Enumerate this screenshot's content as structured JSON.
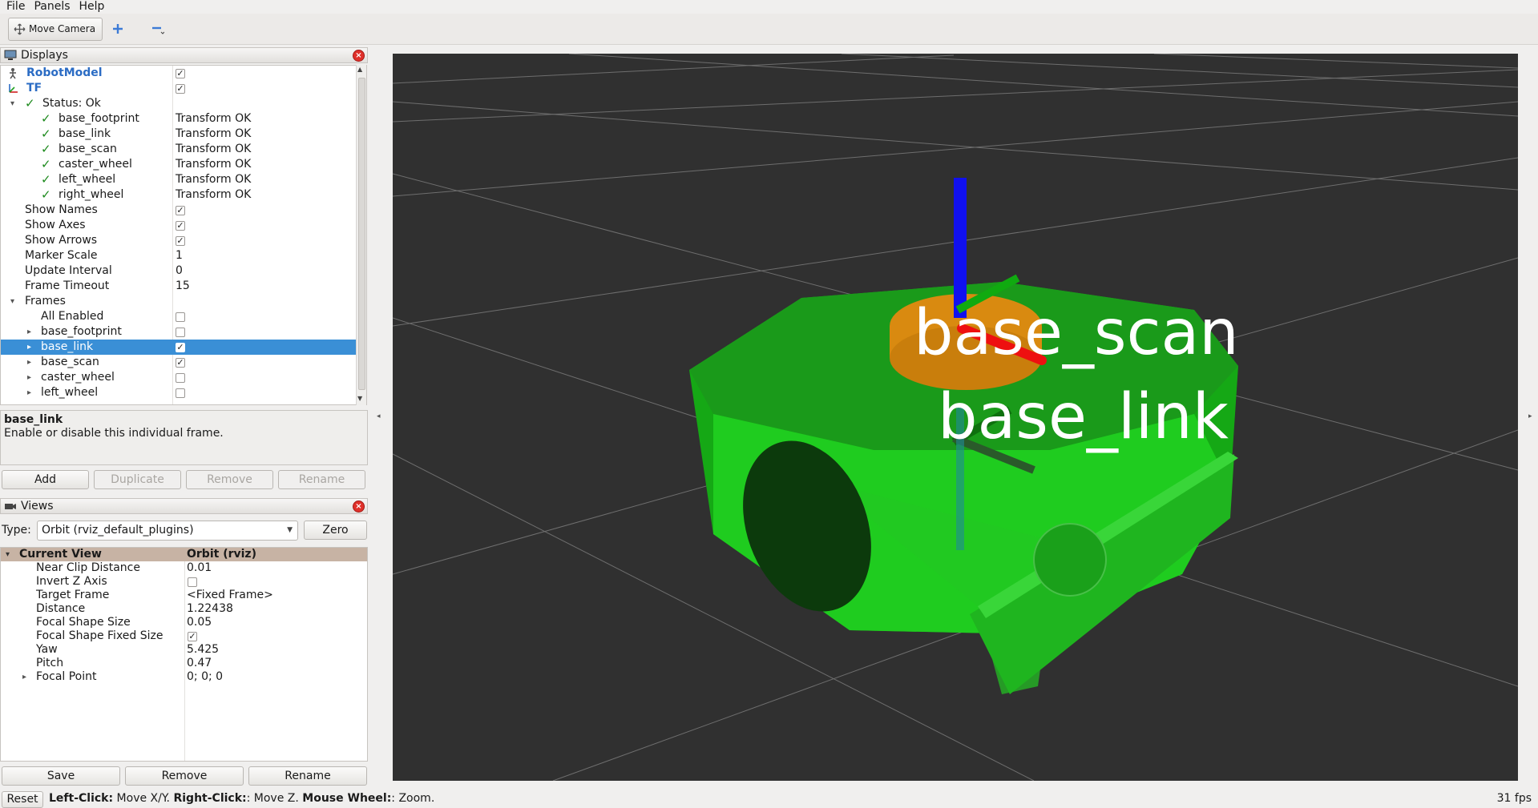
{
  "menu": [
    "File",
    "Panels",
    "Help"
  ],
  "toolbar": {
    "move_camera": "Move Camera"
  },
  "displays_panel": {
    "title": "Displays",
    "rows": [
      {
        "label": "RobotModel",
        "value": "",
        "checked": true
      },
      {
        "label": "TF",
        "value": "",
        "checked": true
      },
      {
        "label": "Status: Ok",
        "value": ""
      },
      {
        "label": "base_footprint",
        "value": "Transform OK"
      },
      {
        "label": "base_link",
        "value": "Transform OK"
      },
      {
        "label": "base_scan",
        "value": "Transform OK"
      },
      {
        "label": "caster_wheel",
        "value": "Transform OK"
      },
      {
        "label": "left_wheel",
        "value": "Transform OK"
      },
      {
        "label": "right_wheel",
        "value": "Transform OK"
      },
      {
        "label": "Show Names",
        "value": "",
        "checked": true
      },
      {
        "label": "Show Axes",
        "value": "",
        "checked": true
      },
      {
        "label": "Show Arrows",
        "value": "",
        "checked": true
      },
      {
        "label": "Marker Scale",
        "value": "1"
      },
      {
        "label": "Update Interval",
        "value": "0"
      },
      {
        "label": "Frame Timeout",
        "value": "15"
      },
      {
        "label": "Frames",
        "value": ""
      },
      {
        "label": "All Enabled",
        "value": "",
        "checked": false
      },
      {
        "label": "base_footprint",
        "value": "",
        "checked": false
      },
      {
        "label": "base_link",
        "value": "",
        "checked": true
      },
      {
        "label": "base_scan",
        "value": "",
        "checked": true
      },
      {
        "label": "caster_wheel",
        "value": "",
        "checked": false
      },
      {
        "label": "left_wheel",
        "value": "",
        "checked": false
      }
    ],
    "desc_title": "base_link",
    "desc_text": "Enable or disable this individual frame.",
    "buttons": [
      "Add",
      "Duplicate",
      "Remove",
      "Rename"
    ]
  },
  "views_panel": {
    "title": "Views",
    "type_label": "Type:",
    "type_value": "Orbit (rviz_default_plugins)",
    "zero_label": "Zero",
    "header_label": "Current View",
    "header_value": "Orbit (rviz)",
    "rows": [
      {
        "label": "Near Clip Distance",
        "value": "0.01"
      },
      {
        "label": "Invert Z Axis",
        "value": ""
      },
      {
        "label": "Target Frame",
        "value": "<Fixed Frame>"
      },
      {
        "label": "Distance",
        "value": "1.22438"
      },
      {
        "label": "Focal Shape Size",
        "value": "0.05"
      },
      {
        "label": "Focal Shape Fixed Size",
        "value": ""
      },
      {
        "label": "Yaw",
        "value": "5.425"
      },
      {
        "label": "Pitch",
        "value": "0.47"
      },
      {
        "label": "Focal Point",
        "value": "0; 0; 0"
      }
    ],
    "buttons": [
      "Save",
      "Remove",
      "Rename"
    ]
  },
  "viewport": {
    "labels": [
      "base_scan",
      "base_link"
    ],
    "colors": {
      "background": "#303030",
      "robot_body": "#22c022",
      "lidar": "#d98a10",
      "axis_z": "#1010ee",
      "axis_x": "#ee1010",
      "axis_y": "#10cc10"
    }
  },
  "status": {
    "reset": "Reset",
    "left_click": "Left-Click:",
    "left_text": " Move X/Y. ",
    "right_click": "Right-Click:",
    "right_text": ": Move Z. ",
    "wheel": "Mouse Wheel:",
    "wheel_text": ": Zoom.",
    "fps": "31 fps"
  }
}
